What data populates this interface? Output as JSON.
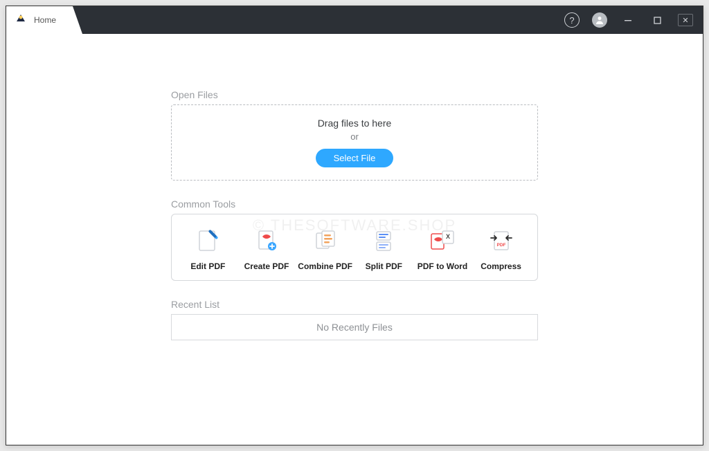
{
  "titlebar": {
    "tab_label": "Home"
  },
  "open_files": {
    "heading": "Open Files",
    "drag_text": "Drag files to here",
    "or_text": "or",
    "button_label": "Select File"
  },
  "common_tools": {
    "heading": "Common Tools",
    "items": [
      {
        "label": "Edit PDF"
      },
      {
        "label": "Create PDF"
      },
      {
        "label": "Combine PDF"
      },
      {
        "label": "Split PDF"
      },
      {
        "label": "PDF to Word"
      },
      {
        "label": "Compress"
      }
    ]
  },
  "recent": {
    "heading": "Recent List",
    "empty_text": "No Recently Files"
  },
  "watermark": "© THESOFTWARE.SHOP"
}
